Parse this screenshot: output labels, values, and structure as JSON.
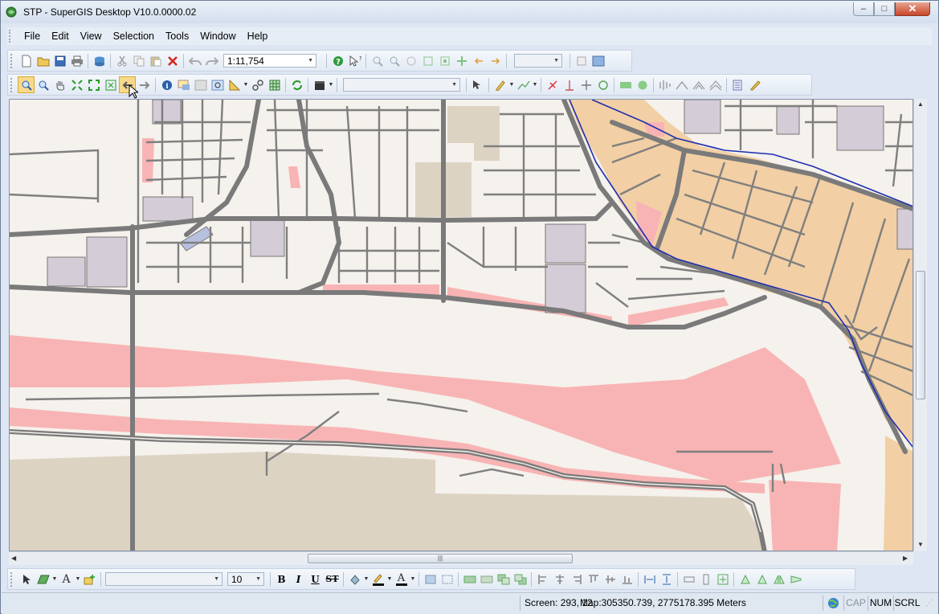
{
  "window": {
    "title": "STP - SuperGIS Desktop V10.0.0000.02",
    "minimize_glyph": "–",
    "maximize_glyph": "□",
    "close_glyph": "✕"
  },
  "menubar": {
    "items": [
      "File",
      "Edit",
      "View",
      "Selection",
      "Tools",
      "Window",
      "Help"
    ]
  },
  "standard_toolbar": {
    "scale_value": "1:11,754",
    "icons": [
      "new-document",
      "open-folder",
      "save",
      "print",
      "add-data",
      "cut",
      "copy",
      "paste",
      "delete",
      "undo",
      "redo",
      "help",
      "whats-this",
      "zoom-in-fixed",
      "zoom-out-fixed",
      "previous-extent",
      "full-extent",
      "zoom-to-layer",
      "pan-fixed",
      "back-extent",
      "forward-extent",
      "layout-view",
      "data-view"
    ]
  },
  "tools_toolbar": {
    "layer_combo_value": "",
    "icons": [
      "zoom-in",
      "zoom-out",
      "pan",
      "full-extent",
      "fixed-zoom",
      "zoom-to-selected",
      "back",
      "forward",
      "identify",
      "map-tips",
      "hyperlink",
      "magnifier",
      "measure",
      "hyperlink-tool",
      "grid",
      "refresh",
      "clapperboard",
      "select-feature",
      "edit-pencil",
      "sketch",
      "split",
      "perpendicular",
      "intersect",
      "snap",
      "rectangle",
      "ellipse",
      "rotate",
      "vertex",
      "reshape",
      "reshape-2",
      "attributes",
      "edit-table"
    ]
  },
  "draw_toolbar": {
    "font_value": "",
    "font_size_value": "10",
    "bold_label": "B",
    "italic_label": "I",
    "underline_label": "U",
    "strike_label": "ST",
    "text_tool_label": "A",
    "font_color_label": "A"
  },
  "statusbar": {
    "screen_coords": "Screen: 293, 12",
    "map_coords": "Map:305350.739, 2775178.395 Meters",
    "cap_label": "CAP",
    "num_label": "NUM",
    "scrl_label": "SCRL"
  },
  "colors": {
    "map_background": "#f5f1ec",
    "road": "#7f7f7f",
    "residential_orange": "#f2cfa4",
    "pink_zone": "#f8b4b4",
    "tan_block": "#ddd3c3",
    "lavender_building": "#d4ccd6",
    "boundary_blue": "#1f2fb0"
  }
}
